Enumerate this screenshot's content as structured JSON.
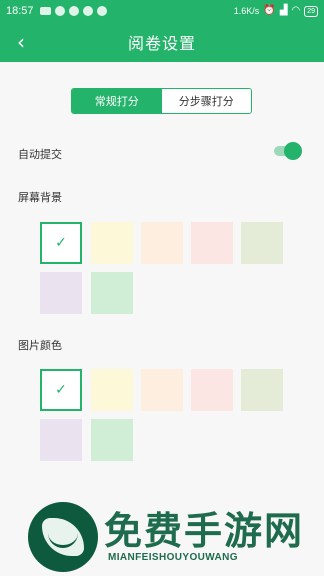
{
  "status_bar": {
    "time": "18:57",
    "network_speed": "1.6K/s",
    "battery_level": "29",
    "icons": [
      "message-icon",
      "drop-icon",
      "circle-icon",
      "color-wheel-icon",
      "circle-icon",
      "alarm-icon",
      "signal-icon",
      "wifi-icon",
      "battery-icon"
    ]
  },
  "header": {
    "title": "阅卷设置",
    "back_icon": "chevron-left-icon"
  },
  "segment": {
    "tabs": [
      {
        "label": "常规打分",
        "active": true
      },
      {
        "label": "分步骤打分",
        "active": false
      }
    ]
  },
  "settings": {
    "auto_submit": {
      "label": "自动提交",
      "enabled": true
    },
    "screen_background": {
      "label": "屏幕背景",
      "selected_index": 0,
      "colors": [
        "#ffffff",
        "#fdf9d8",
        "#fdeee0",
        "#fbe6e3",
        "#e4ecd8",
        "#ebe2f0",
        "#cfeed5"
      ]
    },
    "image_color": {
      "label": "图片颜色",
      "selected_index": 0,
      "colors": [
        "#ffffff",
        "#fdf9d8",
        "#fdeee0",
        "#fbe6e3",
        "#e4ecd8",
        "#ebe2f0",
        "#cfeed5"
      ]
    }
  },
  "theme": {
    "accent": "#24b36b",
    "background": "#f7f7f7"
  },
  "watermark": {
    "title": "免费手游网",
    "subtitle": "MIANFEISHOUYOUWANG"
  }
}
